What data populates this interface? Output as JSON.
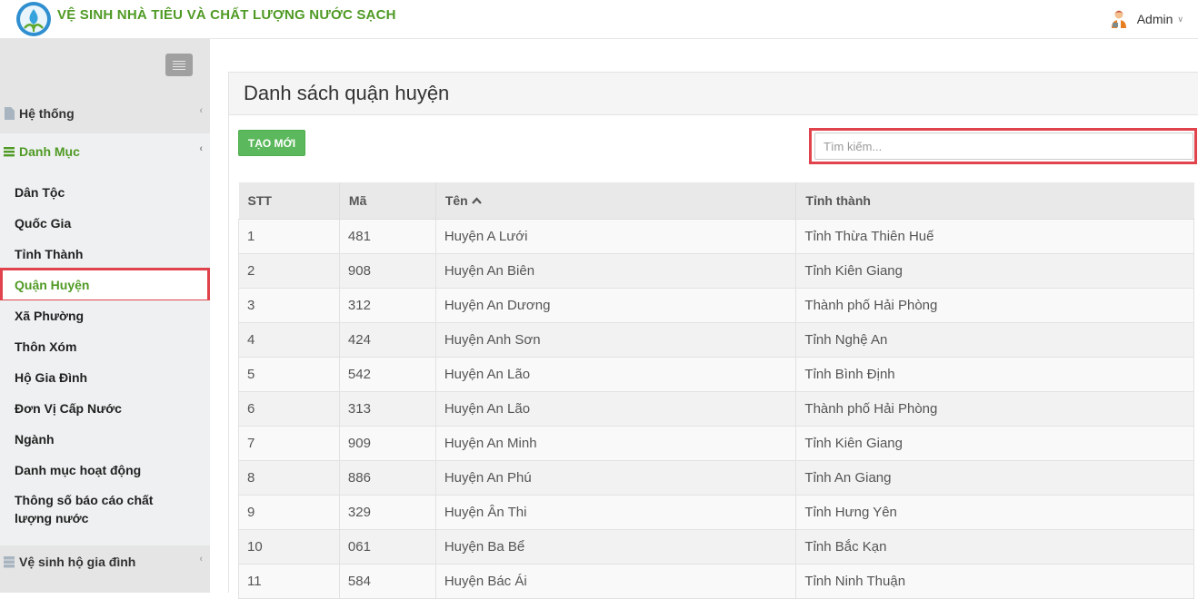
{
  "header": {
    "app_title": "VỆ SINH NHÀ TIÊU VÀ CHẤT LƯỢNG NƯỚC SẠCH",
    "user_name": "Admin",
    "brand_color": "#4f9a24"
  },
  "sidebar": {
    "groups": [
      {
        "label": "Hệ thống",
        "icon": "file-icon"
      },
      {
        "label": "Danh Mục",
        "icon": "list-icon"
      },
      {
        "label": "Vệ sinh hộ gia đình",
        "icon": "server-icon"
      }
    ],
    "items": [
      {
        "label": "Dân Tộc"
      },
      {
        "label": "Quốc Gia"
      },
      {
        "label": "Tỉnh Thành"
      },
      {
        "label": "Quận Huyện"
      },
      {
        "label": "Xã Phường"
      },
      {
        "label": "Thôn Xóm"
      },
      {
        "label": "Hộ Gia Đình"
      },
      {
        "label": "Đơn Vị Cấp Nước"
      },
      {
        "label": "Ngành"
      },
      {
        "label": "Danh mục hoạt động"
      },
      {
        "label": "Thông số báo cáo chất lượng nước"
      }
    ],
    "selected_item": "Quận Huyện"
  },
  "main": {
    "title": "Danh sách quận huyện",
    "new_button": "TẠO MỚI",
    "search_placeholder": "Tìm kiếm...",
    "columns": [
      "STT",
      "Mã",
      "Tên",
      "Tỉnh thành"
    ],
    "sorted_column": "Tên",
    "rows": [
      [
        "1",
        "481",
        "Huyện A Lưới",
        "Tỉnh Thừa Thiên Huế"
      ],
      [
        "2",
        "908",
        "Huyện An Biên",
        "Tỉnh Kiên Giang"
      ],
      [
        "3",
        "312",
        "Huyện An Dương",
        "Thành phố Hải Phòng"
      ],
      [
        "4",
        "424",
        "Huyện Anh Sơn",
        "Tỉnh Nghệ An"
      ],
      [
        "5",
        "542",
        "Huyện An Lão",
        "Tỉnh Bình Định"
      ],
      [
        "6",
        "313",
        "Huyện An Lão",
        "Thành phố Hải Phòng"
      ],
      [
        "7",
        "909",
        "Huyện An Minh",
        "Tỉnh Kiên Giang"
      ],
      [
        "8",
        "886",
        "Huyện An Phú",
        "Tỉnh An Giang"
      ],
      [
        "9",
        "329",
        "Huyện Ân Thi",
        "Tỉnh Hưng Yên"
      ],
      [
        "10",
        "061",
        "Huyện Ba Bể",
        "Tỉnh Bắc Kạn"
      ],
      [
        "11",
        "584",
        "Huyện Bác Ái",
        "Tỉnh Ninh Thuận"
      ]
    ]
  }
}
